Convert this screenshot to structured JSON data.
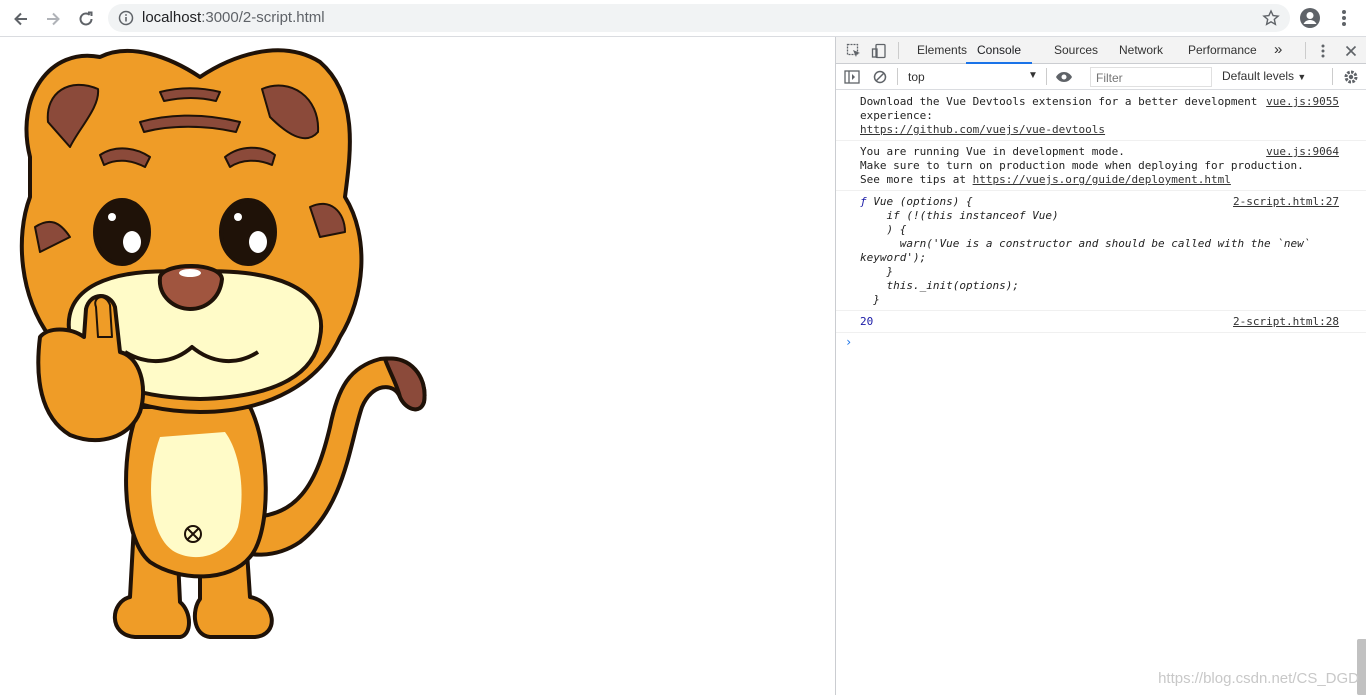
{
  "browser": {
    "url_host": "localhost",
    "url_rest": ":3000/2-script.html"
  },
  "devtools": {
    "tabs": [
      "Elements",
      "Console",
      "Sources",
      "Network",
      "Performance"
    ],
    "more_tabs_icon": "»",
    "context": "top",
    "filter_placeholder": "Filter",
    "levels": "Default levels"
  },
  "console": {
    "messages": [
      {
        "lines": [
          "Download the Vue Devtools extension for a better development",
          "experience:"
        ],
        "link": "https://github.com/vuejs/vue-devtools",
        "source": "vue.js:9055"
      },
      {
        "lines": [
          "You are running Vue in development mode.",
          "Make sure to turn on production mode when deploying for production."
        ],
        "tips_prefix": "See more tips at ",
        "link": "https://vuejs.org/guide/deployment.html",
        "source": "vue.js:9064"
      },
      {
        "fn_keyword": "ƒ",
        "lines": [
          " Vue (options) {",
          "    if (!(this instanceof Vue)",
          "    ) {",
          "      warn('Vue is a constructor and should be called with the `new`",
          "keyword');",
          "    }",
          "    this._init(options);",
          "  }"
        ],
        "source": "2-script.html:27"
      },
      {
        "value": "20",
        "source": "2-script.html:28"
      }
    ],
    "prompt": "›"
  },
  "watermark": "https://blog.csdn.net/CS_DGD"
}
